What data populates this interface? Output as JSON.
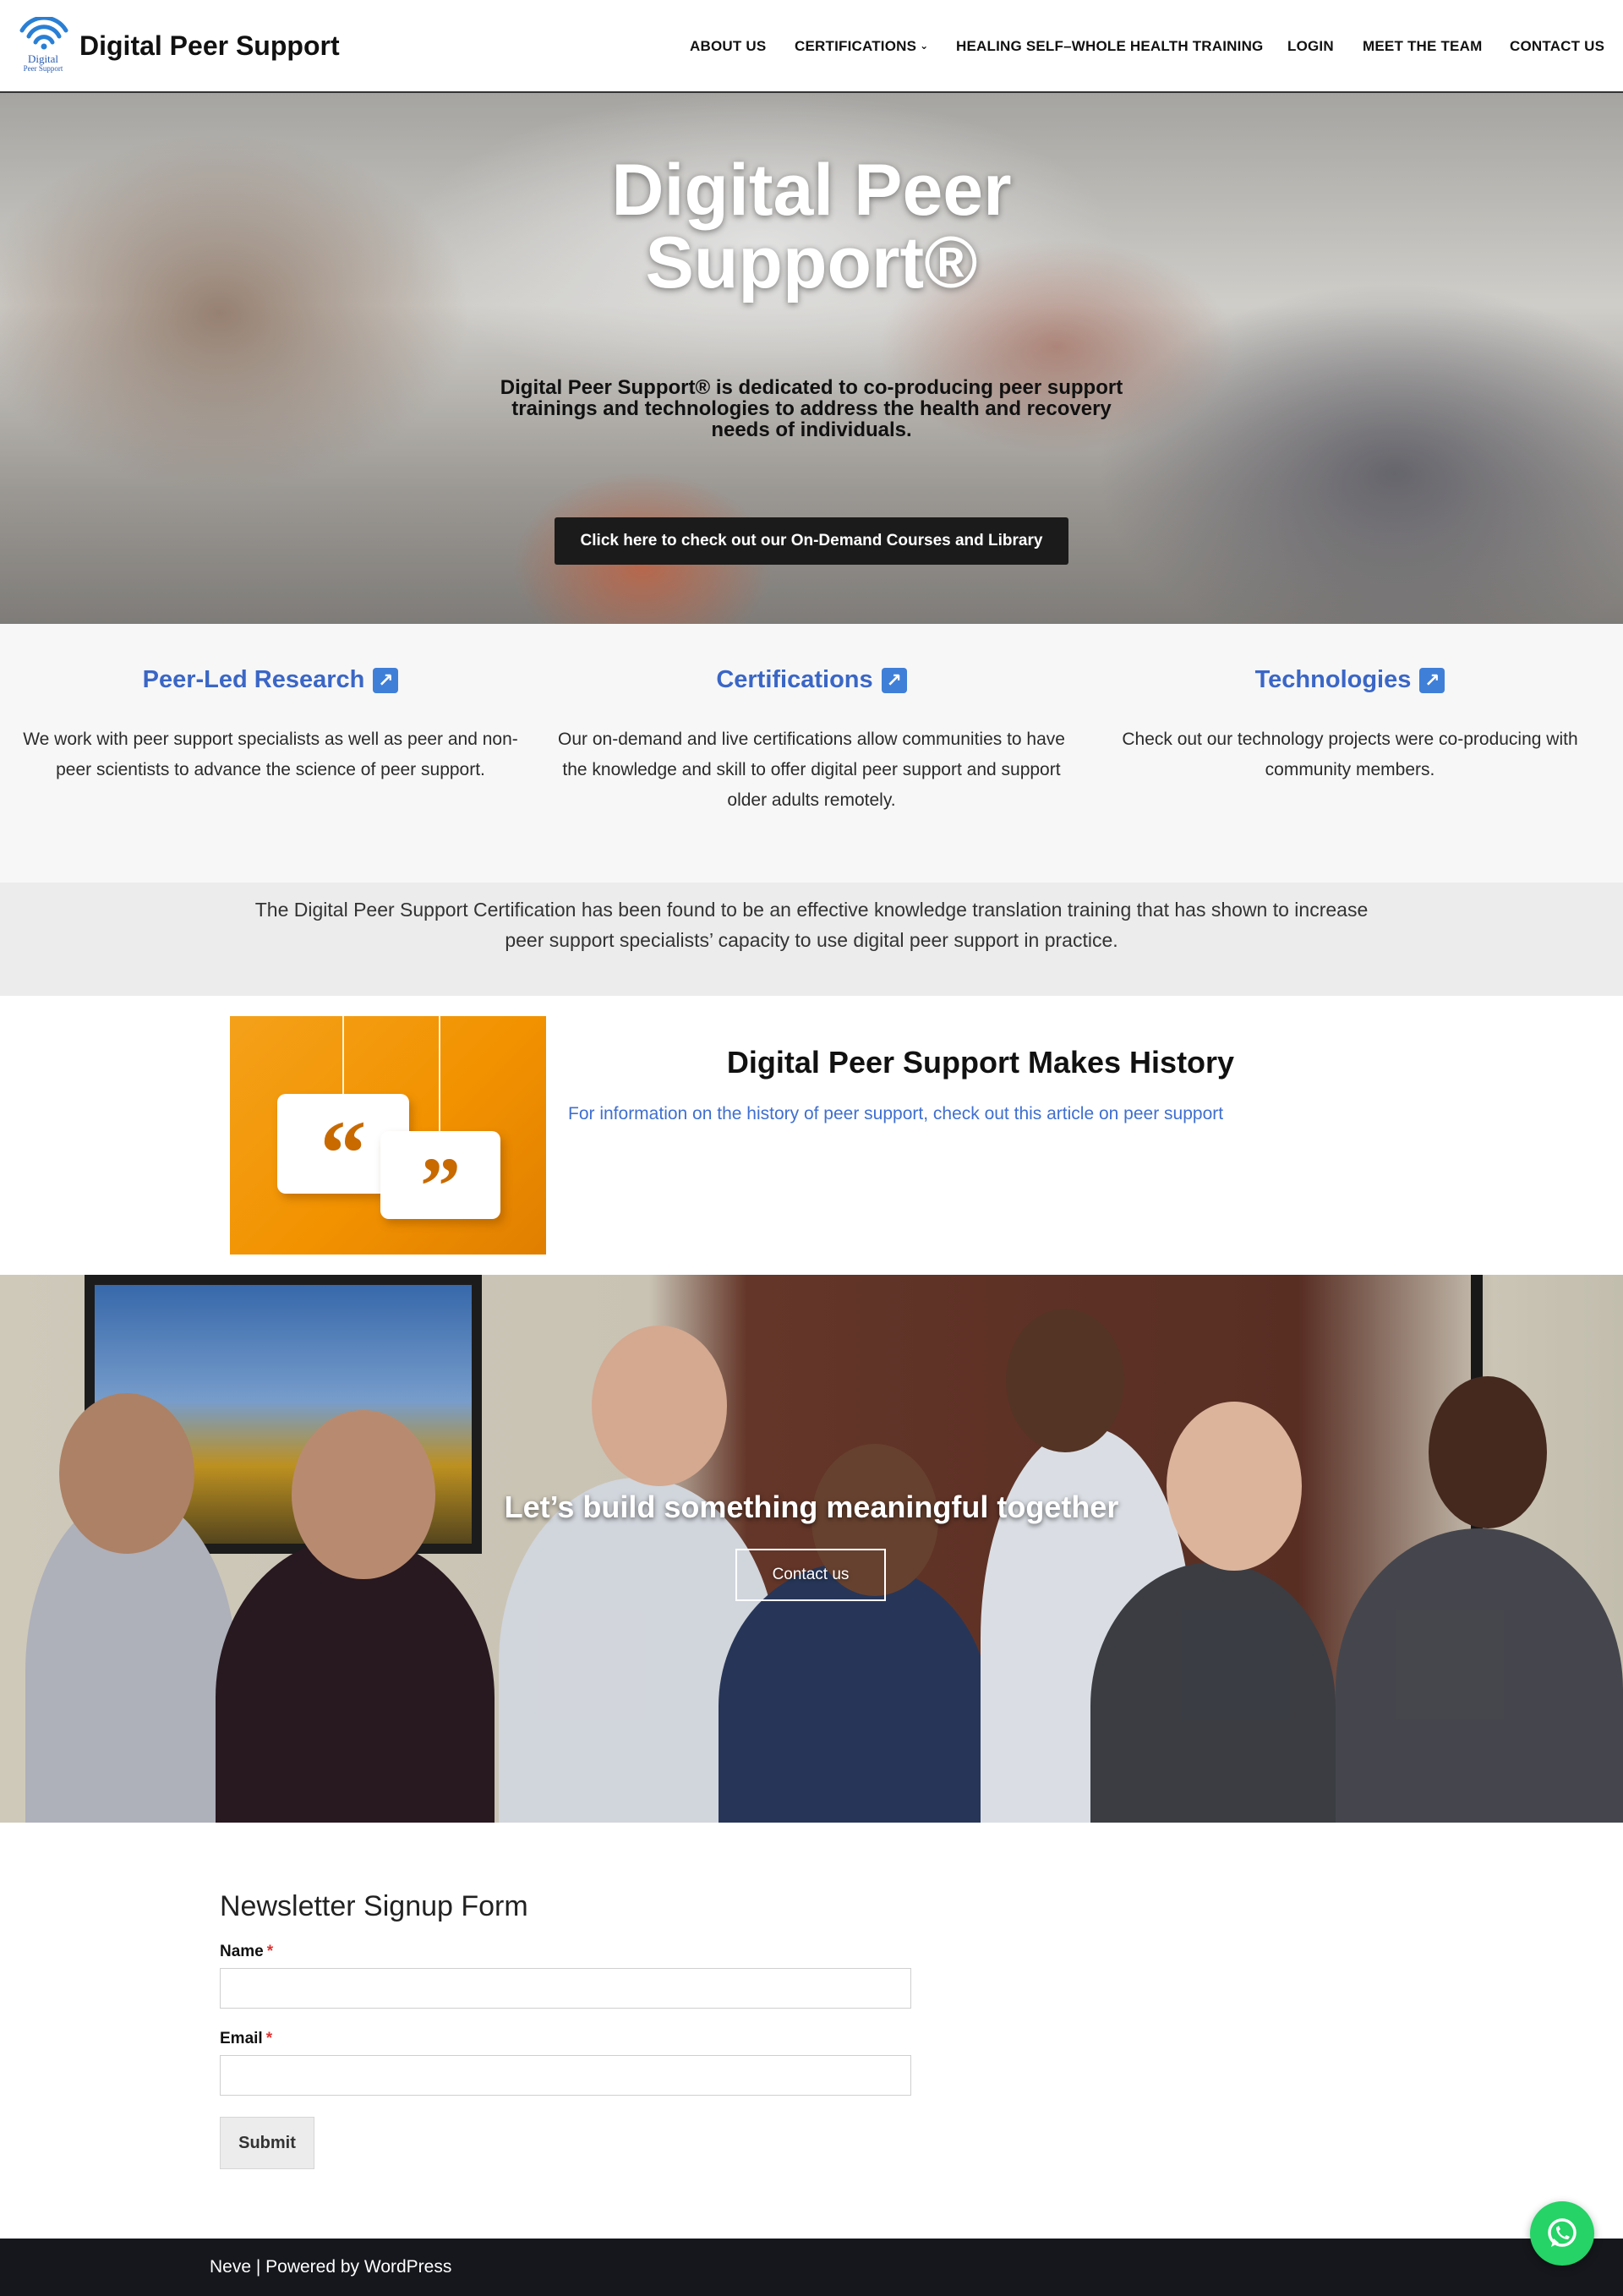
{
  "header": {
    "site_title": "Digital Peer Support",
    "logo_text_line1": "Digital",
    "logo_text_line2": "Peer Support",
    "nav": [
      {
        "label": "ABOUT US"
      },
      {
        "label": "CERTIFICATIONS",
        "has_dropdown": true
      },
      {
        "label": "HEALING SELF–WHOLE HEALTH TRAINING"
      },
      {
        "label": "LOGIN"
      },
      {
        "label": "MEET THE TEAM"
      },
      {
        "label": "CONTACT US"
      }
    ]
  },
  "hero": {
    "title_line1": "Digital Peer",
    "title_line2": "Support®",
    "description": "Digital Peer Support® is dedicated to co-producing peer support trainings and technologies to address the health and recovery needs of individuals.",
    "button_label": "Click here to check out our On-Demand Courses and Library"
  },
  "features": [
    {
      "title": "Peer-Led Research",
      "icon": "external-link-arrow-icon",
      "text": "We work with peer support specialists as well as peer and non-peer scientists to advance the science of peer support."
    },
    {
      "title": "Certifications",
      "icon": "external-link-arrow-icon",
      "text": "Our on-demand and live certifications allow communities to have the knowledge and skill to offer digital peer support and support older adults remotely."
    },
    {
      "title": "Technologies",
      "icon": "external-link-arrow-icon",
      "text": "Check out our technology projects were co-producing with community members."
    }
  ],
  "cert_band": {
    "text": "The Digital Peer Support Certification has been found to be an effective knowledge translation training that has shown to increase peer support specialists’ capacity to use digital peer support in practice."
  },
  "history": {
    "title": "Digital Peer Support Makes History",
    "link_text": "For information on the history of peer support, check out this article on peer support",
    "quote_open": "“",
    "quote_close": "”"
  },
  "team_banner": {
    "headline": "Let’s build something meaningful together",
    "button_label": "Contact us"
  },
  "newsletter": {
    "title": "Newsletter Signup Form",
    "name_label": "Name",
    "email_label": "Email",
    "required_mark": "*",
    "name_value": "",
    "email_value": "",
    "submit_label": "Submit"
  },
  "footer": {
    "text": "Neve | Powered by WordPress"
  },
  "colors": {
    "accent_blue": "#3a66c6",
    "footer_bg": "#15171c",
    "whatsapp_green": "#25d366"
  }
}
